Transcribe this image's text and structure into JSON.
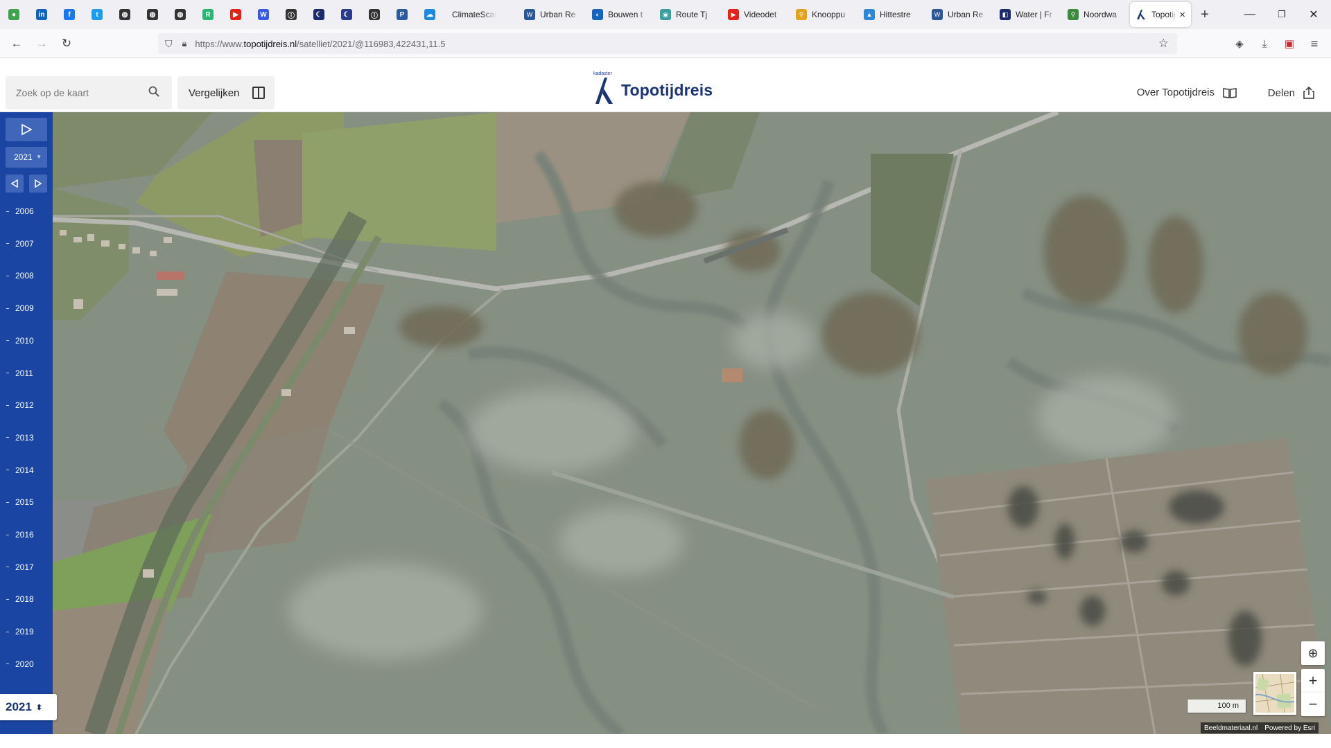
{
  "browser": {
    "pinned_icons": [
      {
        "name": "green-circle-icon",
        "color": "#3fa34d",
        "glyph": "●"
      },
      {
        "name": "linkedin-icon",
        "color": "#0a66c2",
        "glyph": "in"
      },
      {
        "name": "facebook-icon",
        "color": "#1877f2",
        "glyph": "f"
      },
      {
        "name": "twitter-icon",
        "color": "#1d9bf0",
        "glyph": "t"
      },
      {
        "name": "globe-icon",
        "color": "#333333",
        "glyph": "◍"
      },
      {
        "name": "globe-icon",
        "color": "#333333",
        "glyph": "◍"
      },
      {
        "name": "globe-icon",
        "color": "#333333",
        "glyph": "◍"
      },
      {
        "name": "app-icon",
        "color": "#2bb673",
        "glyph": "R"
      },
      {
        "name": "youtube-icon",
        "color": "#e62117",
        "glyph": "▶"
      },
      {
        "name": "wordpress-icon",
        "color": "#3858e9",
        "glyph": "W"
      },
      {
        "name": "info-icon",
        "color": "#333333",
        "glyph": "ⓘ"
      },
      {
        "name": "moon-icon",
        "color": "#1a2a6c",
        "glyph": "☾"
      },
      {
        "name": "moon-icon",
        "color": "#2a3a8c",
        "glyph": "☾"
      },
      {
        "name": "info-icon",
        "color": "#333333",
        "glyph": "ⓘ"
      },
      {
        "name": "p-app-icon",
        "color": "#2c5aa0",
        "glyph": "P"
      },
      {
        "name": "cloud-icon",
        "color": "#1e88e5",
        "glyph": "☁"
      }
    ],
    "tabs": [
      {
        "label": "ClimateScan",
        "icon_color": "#888888",
        "icon": "",
        "first": true
      },
      {
        "label": "Urban Re",
        "icon_color": "#2b579a",
        "icon": "W"
      },
      {
        "label": "Bouwen t",
        "icon_color": "#1565c0",
        "icon": "◐"
      },
      {
        "label": "Route Tj",
        "icon_color": "#3aa0a0",
        "icon": "◉"
      },
      {
        "label": "Videodet",
        "icon_color": "#e62117",
        "icon": "▶"
      },
      {
        "label": "Knooppu",
        "icon_color": "#e4a11b",
        "icon": "⚲"
      },
      {
        "label": "Hittestre",
        "icon_color": "#2c87d8",
        "icon": "▲"
      },
      {
        "label": "Urban Re",
        "icon_color": "#2b579a",
        "icon": "W"
      },
      {
        "label": "Water | Fr",
        "icon_color": "#1a2a6c",
        "icon": "◧"
      },
      {
        "label": "Noordwa",
        "icon_color": "#3b8a3e",
        "icon": "⚲"
      }
    ],
    "active_tab": {
      "label": "Topotij",
      "close": "×"
    },
    "new_tab": "+",
    "window": {
      "minimize": "—",
      "restore": "❐",
      "close": "✕"
    },
    "nav": {
      "back": "←",
      "forward": "→",
      "reload": "↻"
    },
    "url": {
      "prefix": "https://www.",
      "domain": "topotijdreis.nl",
      "path": "/satelliet/2021/@116983,422431,11.5"
    },
    "toolbar": {
      "star": "☆",
      "pocket": "◈",
      "download": "⤓",
      "pdf": "▣",
      "menu": "≡"
    }
  },
  "header": {
    "search_placeholder": "Zoek op de kaart",
    "compare_label": "Vergelijken",
    "brand_small": "kadaster",
    "brand_name": "Topotijdreis",
    "about_label": "Over Topotijdreis",
    "share_label": "Delen"
  },
  "timeline": {
    "selected_year": "2021",
    "years": [
      "2006",
      "2007",
      "2008",
      "2009",
      "2010",
      "2011",
      "2012",
      "2013",
      "2014",
      "2015",
      "2016",
      "2017",
      "2018",
      "2019",
      "2020"
    ],
    "current_year_label": "2021",
    "current_year_arrow": "⬍"
  },
  "map": {
    "scale_label": "100 m",
    "credit_imagery": "Beeldmateriaal.nl",
    "credit_powered": "Powered by Esri",
    "zoom_in": "+",
    "zoom_out": "−",
    "locate": "⊕"
  },
  "colors": {
    "timeline_bg": "#1a45a3",
    "timeline_button": "#3f66b8",
    "brand_blue": "#1a3376"
  }
}
